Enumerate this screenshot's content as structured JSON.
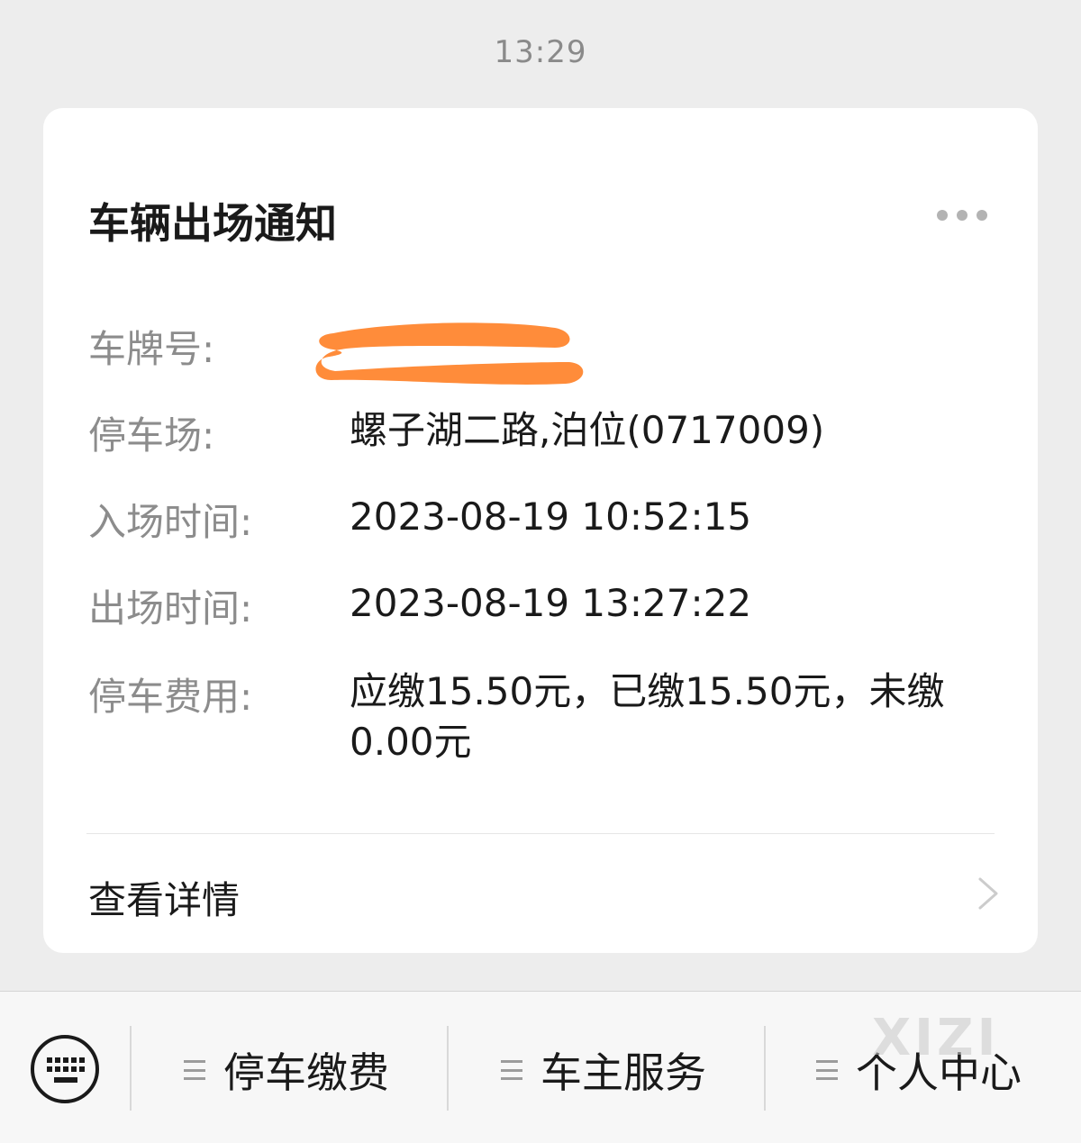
{
  "timestamp": "13:29",
  "card": {
    "title": "车辆出场通知",
    "more_icon": "more-horizontal-icon",
    "rows": [
      {
        "label": "车牌号:",
        "value": ""
      },
      {
        "label": "停车场:",
        "value": "螺子湖二路,泊位(0717009)"
      },
      {
        "label": "入场时间:",
        "value": "2023-08-19 10:52:15"
      },
      {
        "label": "出场时间:",
        "value": "2023-08-19 13:27:22"
      },
      {
        "label": "停车费用:",
        "value": "应缴15.50元，已缴15.50元，未缴0.00元"
      }
    ],
    "redaction_color": "#ff8c3a",
    "detail_link": "查看详情",
    "chevron_icon": "chevron-right-icon"
  },
  "bottom_bar": {
    "keyboard_icon": "keyboard-icon",
    "menus": [
      {
        "label": "停车缴费",
        "icon": "menu-icon"
      },
      {
        "label": "车主服务",
        "icon": "menu-icon"
      },
      {
        "label": "个人中心",
        "icon": "menu-icon"
      }
    ]
  },
  "watermark": "XIZI"
}
